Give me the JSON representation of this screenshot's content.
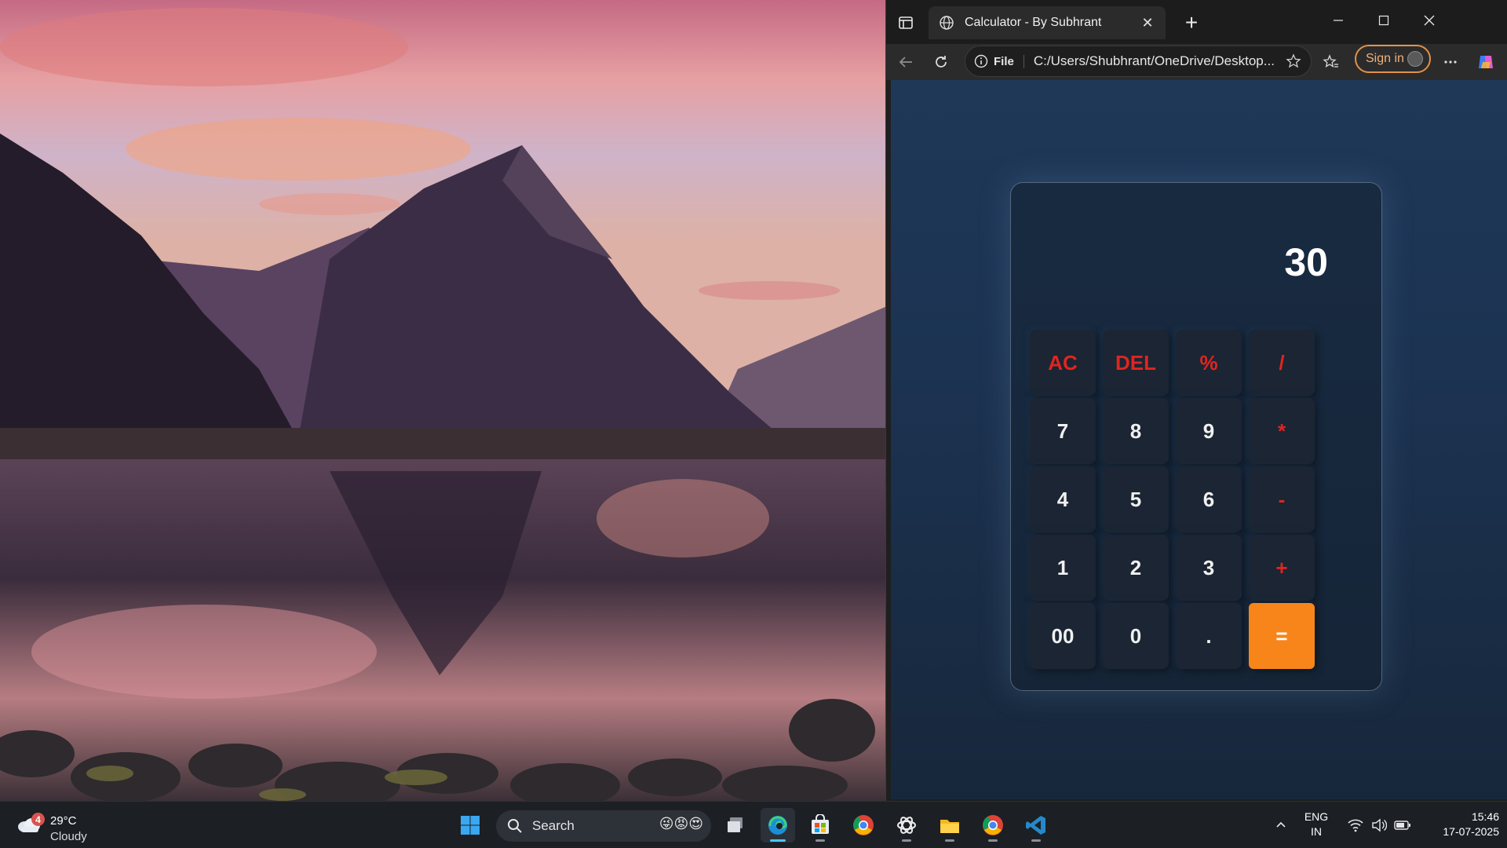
{
  "browser": {
    "tab_title": "Calculator - By Subhrant",
    "url_scheme_chip": "File",
    "url": "C:/Users/Shubhrant/OneDrive/Desktop...",
    "signin_label": "Sign in"
  },
  "calculator": {
    "display": "30",
    "keys": [
      {
        "label": "AC",
        "kind": "op"
      },
      {
        "label": "DEL",
        "kind": "op"
      },
      {
        "label": "%",
        "kind": "op"
      },
      {
        "label": "/",
        "kind": "op"
      },
      {
        "label": "7",
        "kind": "num"
      },
      {
        "label": "8",
        "kind": "num"
      },
      {
        "label": "9",
        "kind": "num"
      },
      {
        "label": "*",
        "kind": "op"
      },
      {
        "label": "4",
        "kind": "num"
      },
      {
        "label": "5",
        "kind": "num"
      },
      {
        "label": "6",
        "kind": "num"
      },
      {
        "label": "-",
        "kind": "op"
      },
      {
        "label": "1",
        "kind": "num"
      },
      {
        "label": "2",
        "kind": "num"
      },
      {
        "label": "3",
        "kind": "num"
      },
      {
        "label": "+",
        "kind": "op"
      },
      {
        "label": "00",
        "kind": "num"
      },
      {
        "label": "0",
        "kind": "num"
      },
      {
        "label": ".",
        "kind": "num"
      },
      {
        "label": "=",
        "kind": "eq"
      }
    ],
    "colors": {
      "operator": "#e0251f",
      "equals": "#f7851a"
    }
  },
  "taskbar": {
    "weather_badge": "4",
    "temperature": "29°C",
    "condition": "Cloudy",
    "search_placeholder": "Search",
    "search_emoji": "😜😡😍",
    "lang_line1": "ENG",
    "lang_line2": "IN",
    "time": "15:46",
    "date": "17-07-2025",
    "pinned_apps": [
      "windows-start-icon",
      "task-view-icon",
      "edge-icon",
      "microsoft-store-icon",
      "chrome-icon",
      "chatgpt-icon",
      "file-explorer-icon",
      "chrome-icon",
      "vscode-icon"
    ]
  }
}
